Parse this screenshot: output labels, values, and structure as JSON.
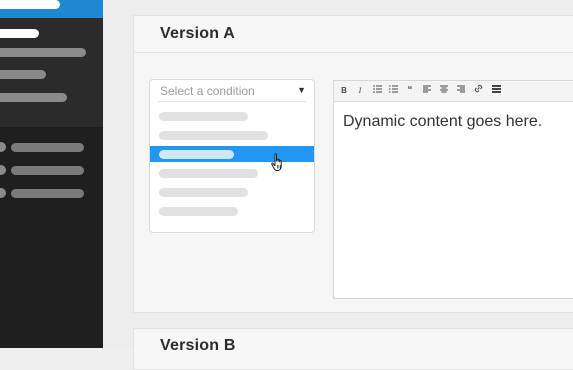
{
  "version_a": {
    "title": "Version A",
    "condition_select": {
      "placeholder": "Select a condition",
      "caret": "▼",
      "option_count": 6,
      "selected_index": 2
    },
    "editor": {
      "toolbar": [
        "bold-icon",
        "italic-icon",
        "bulleted-list-icon",
        "numbered-list-icon",
        "blockquote-icon",
        "align-left-icon",
        "align-center-icon",
        "align-right-icon",
        "link-icon",
        "more-icon"
      ],
      "content": "Dynamic content goes here."
    }
  },
  "version_b": {
    "title": "Version B"
  },
  "colors": {
    "accent": "#2196f3",
    "sidebar_active": "#1e88d2",
    "sidebar_bg": "#1f1f1f"
  }
}
